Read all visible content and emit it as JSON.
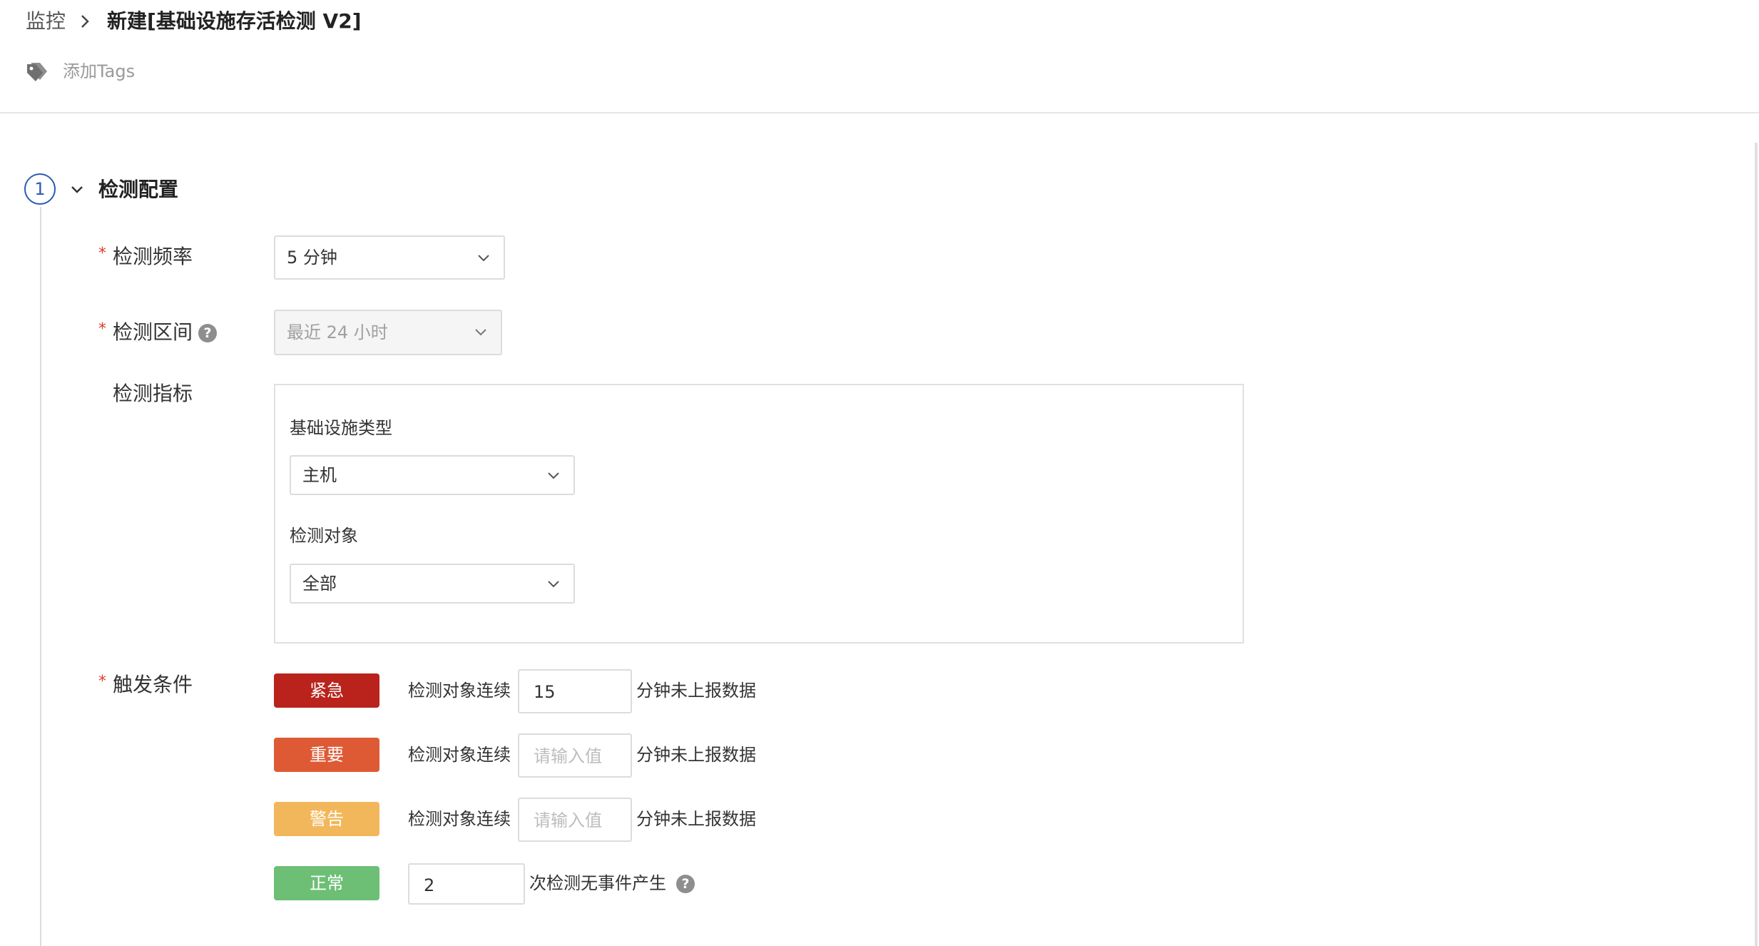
{
  "breadcrumb": {
    "root": "监控",
    "current": "新建[基础设施存活检测 V2]"
  },
  "tags": {
    "add_label": "添加Tags"
  },
  "step": {
    "number": "1",
    "title": "检测配置"
  },
  "form": {
    "frequency": {
      "label": "检测频率",
      "value": "5 分钟"
    },
    "range": {
      "label": "检测区间",
      "value": "最近 24 小时"
    },
    "metric": {
      "label": "检测指标",
      "infra_type_label": "基础设施类型",
      "infra_type_value": "主机",
      "target_label": "检测对象",
      "target_value": "全部"
    },
    "trigger": {
      "label": "触发条件",
      "rows": [
        {
          "severity": "紧急",
          "prefix": "检测对象连续",
          "value": "15",
          "placeholder": "请输入值",
          "suffix": "分钟未上报数据"
        },
        {
          "severity": "重要",
          "prefix": "检测对象连续",
          "value": "",
          "placeholder": "请输入值",
          "suffix": "分钟未上报数据"
        },
        {
          "severity": "警告",
          "prefix": "检测对象连续",
          "value": "",
          "placeholder": "请输入值",
          "suffix": "分钟未上报数据"
        }
      ],
      "normal": {
        "severity": "正常",
        "value": "2",
        "suffix": "次检测无事件产生"
      }
    }
  },
  "colors": {
    "critical": "#b9231c",
    "important": "#de5a35",
    "warning": "#f2b75b",
    "normal": "#6cbf74",
    "step_accent": "#2b5bb5",
    "required": "#e03b30"
  }
}
